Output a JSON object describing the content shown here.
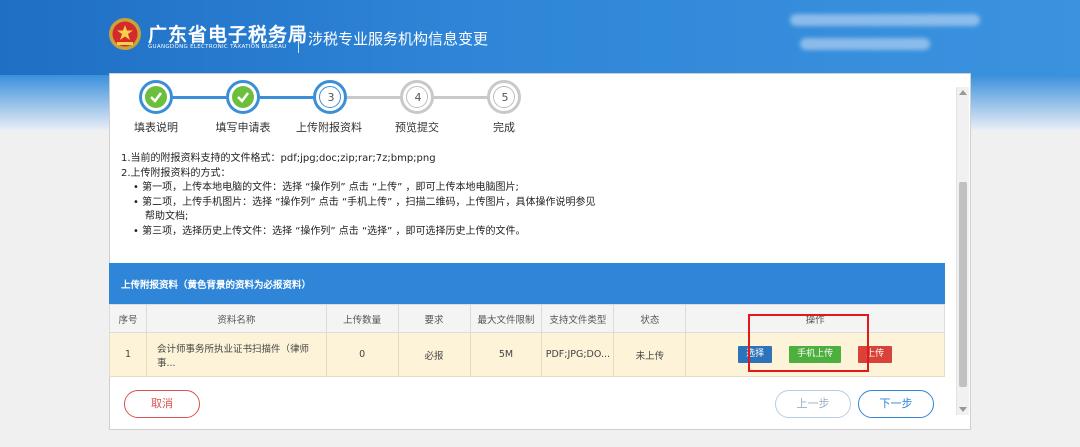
{
  "header": {
    "brand_title": "广东省电子税务局",
    "brand_subtitle": "GUANGDONG ELECTRONIC TAXATION BUREAU",
    "page_title": "涉税专业服务机构信息变更"
  },
  "stepper": {
    "steps": [
      {
        "number": "1",
        "label": "填表说明",
        "state": "done"
      },
      {
        "number": "2",
        "label": "填写申请表",
        "state": "done"
      },
      {
        "number": "3",
        "label": "上传附报资料",
        "state": "active"
      },
      {
        "number": "4",
        "label": "预览提交",
        "state": "inactive"
      },
      {
        "number": "5",
        "label": "完成",
        "state": "inactive"
      }
    ]
  },
  "instructions": {
    "line1": "1.当前的附报资料支持的文件格式：pdf;jpg;doc;zip;rar;7z;bmp;png",
    "line2": "2.上传附报资料的方式：",
    "bullet1": "• 第一项，上传本地电脑的文件：选择 “操作列” 点击 “上传” ，即可上传本地电脑图片;",
    "bullet2a": "• 第二项，上传手机图片：选择 “操作列” 点击 “手机上传” ，扫描二维码，上传图片，具体操作说明参见",
    "bullet2b": "帮助文档;",
    "bullet3": "• 第三项，选择历史上传文件：选择 “操作列” 点击 “选择” ，即可选择历史上传的文件。"
  },
  "upload_section": {
    "title": "上传附报资料（黄色背景的资料为必报资料）",
    "columns": [
      "序号",
      "资料名称",
      "上传数量",
      "要求",
      "最大文件限制",
      "支持文件类型",
      "状态",
      "操作"
    ],
    "rows": [
      {
        "index": "1",
        "name": "会计师事务所执业证书扫描件（律师事...",
        "count": "0",
        "requirement": "必报",
        "max_size": "5M",
        "file_types": "PDF;JPG;DO...",
        "status": "未上传",
        "actions": {
          "choose": "选择",
          "phone_upload": "手机上传",
          "upload": "上传"
        }
      }
    ]
  },
  "footer": {
    "cancel": "取消",
    "prev": "上一步",
    "next": "下一步"
  },
  "colors": {
    "primary_blue": "#2f86d8",
    "done_green": "#6cbf3c",
    "required_row_bg": "#fdf3d8",
    "status_red": "#e02020",
    "highlight_red": "#e01a1a"
  }
}
